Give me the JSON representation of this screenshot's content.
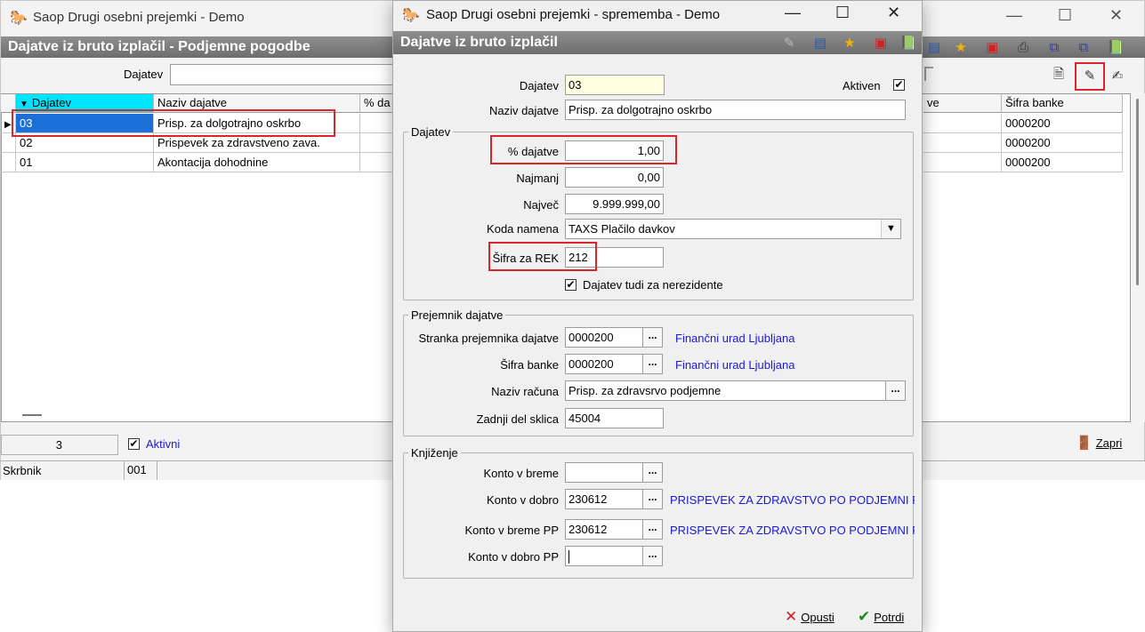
{
  "bg_window": {
    "title": "Saop   Drugi osebni prejemki  - Demo",
    "header": "Dajatve iz bruto izplačil - Podjemne pogodbe",
    "filter_label": "Dajatev",
    "grid": {
      "columns": [
        "Dajatev",
        "Naziv dajatve",
        "% da",
        "ve",
        "Šifra banke"
      ],
      "rows": [
        {
          "code": "03",
          "name": "Prisp. za dolgotrajno oskrbo",
          "bank": "0000200"
        },
        {
          "code": "02",
          "name": "Prispevek za zdravstveno zava.",
          "bank": "0000200"
        },
        {
          "code": "01",
          "name": "Akontacija dohodnine",
          "bank": "0000200"
        }
      ]
    },
    "count": "3",
    "active_label": "Aktivni",
    "close_label": "Zapri",
    "status_label": "Skrbnik",
    "status_value": "001"
  },
  "dialog": {
    "title": "Saop   Drugi osebni prejemki  - sprememba - Demo",
    "header": "Dajatve iz bruto izplačil",
    "fields": {
      "dajatev_label": "Dajatev",
      "dajatev_value": "03",
      "aktiven_label": "Aktiven",
      "naziv_label": "Naziv dajatve",
      "naziv_value": "Prisp. za dolgotrajno oskrbo"
    },
    "group_dajatev": {
      "title": "Dajatev",
      "pct_label": "% dajatve",
      "pct_value": "1,00",
      "najmanj_label": "Najmanj",
      "najmanj_value": "0,00",
      "najvec_label": "Največ",
      "najvec_value": "9.999.999,00",
      "koda_label": "Koda namena",
      "koda_value": "TAXS Plačilo davkov",
      "rek_label": "Šifra za REK",
      "rek_value": "212",
      "nerez_label": "Dajatev tudi za nerezidente"
    },
    "group_prejemnik": {
      "title": "Prejemnik dajatve",
      "stranka_label": "Stranka prejemnika dajatve",
      "stranka_value": "0000200",
      "stranka_link": "Finančni urad Ljubljana",
      "banka_label": "Šifra banke",
      "banka_value": "0000200",
      "banka_link": "Finančni urad Ljubljana",
      "racun_label": "Naziv računa",
      "racun_value": "Prisp. za zdravsrvo podjemne",
      "sklic_label": "Zadnji del sklica",
      "sklic_value": "45004"
    },
    "group_knjizenje": {
      "title": "Knjiženje",
      "breme_label": "Konto v breme",
      "breme_value": "",
      "dobro_label": "Konto v dobro",
      "dobro_value": "230612",
      "dobro_link": "PRISPEVEK ZA ZDRAVSTVO PO PODJEMNI POG",
      "breme_pp_label": "Konto v breme PP",
      "breme_pp_value": "230612",
      "breme_pp_link": "PRISPEVEK ZA ZDRAVSTVO PO PODJEMNI POG",
      "dobro_pp_label": "Konto v dobro PP",
      "dobro_pp_value": ""
    },
    "cancel_label": "Opusti",
    "confirm_label": "Potrdi"
  },
  "colors": {
    "accent_header": "#7a7a7a",
    "sort_header": "#00e5ff",
    "selected_row": "#1c6fd6",
    "highlight_box": "#d9262c",
    "link": "#1a1ad6",
    "code_field": "#ffffe1"
  },
  "icons": [
    "app-logo-icon",
    "edit-icon",
    "list-icon",
    "star-icon",
    "delete-icon",
    "book-icon",
    "print-icon",
    "new-doc-icon",
    "checklist-icon",
    "close-door-icon",
    "cancel-x-icon",
    "confirm-check-icon",
    "dropdown-arrow-icon",
    "ellipsis-icon"
  ]
}
